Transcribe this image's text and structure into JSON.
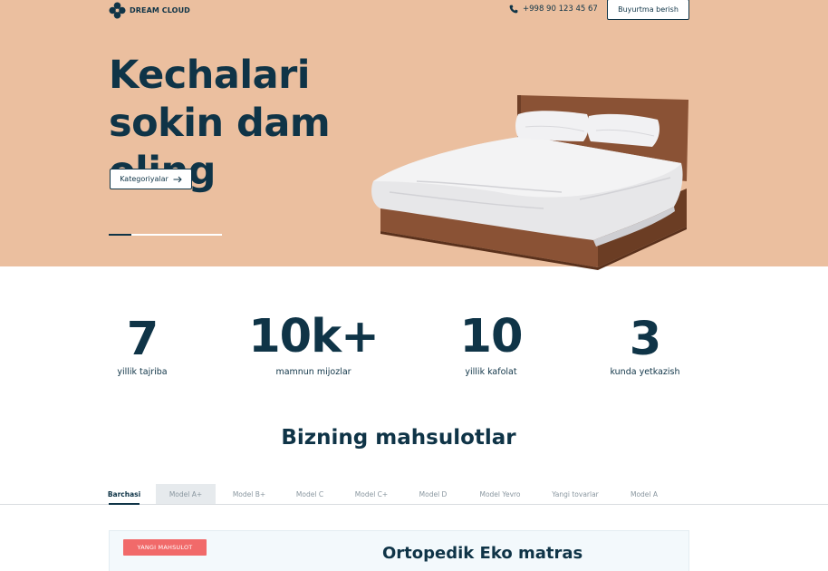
{
  "header": {
    "logo_text": "DREAM CLOUD",
    "logo_icon": "cloud-logo-icon",
    "phone_icon": "phone-icon",
    "phone": "+998 90 123 45 67",
    "order_button": "Buyurtma berish"
  },
  "hero": {
    "title": "Kechalari sokin dam oling",
    "categories_button": "Kategoriyalar",
    "button_icon": "arrow-right-icon",
    "slider": {
      "current": 1,
      "total": 5
    }
  },
  "stats": [
    {
      "value": "7",
      "label": "yillik tajriba"
    },
    {
      "value": "10k+",
      "label": "mamnun mijozlar"
    },
    {
      "value": "10",
      "label": "yillik kafolat"
    },
    {
      "value": "3",
      "label": "kunda yetkazish"
    }
  ],
  "products": {
    "title": "Bizning mahsulotlar",
    "tabs": [
      {
        "label": "Barchasi",
        "active": true
      },
      {
        "label": "Model A+",
        "active": false
      },
      {
        "label": "Model B+",
        "active": false
      },
      {
        "label": "Model C",
        "active": false
      },
      {
        "label": "Model C+",
        "active": false
      },
      {
        "label": "Model D",
        "active": false
      },
      {
        "label": "Model Yevro",
        "active": false
      },
      {
        "label": "Yangi tovarlar",
        "active": false
      },
      {
        "label": "Model A",
        "active": false
      }
    ],
    "card": {
      "badge": "YANGI MAHSULOT",
      "title": "Ortopedik Eko matras"
    }
  },
  "colors": {
    "brand_dark": "#0f3447",
    "hero_bg": "#ebbf9f",
    "badge_red": "#f16a6a"
  }
}
